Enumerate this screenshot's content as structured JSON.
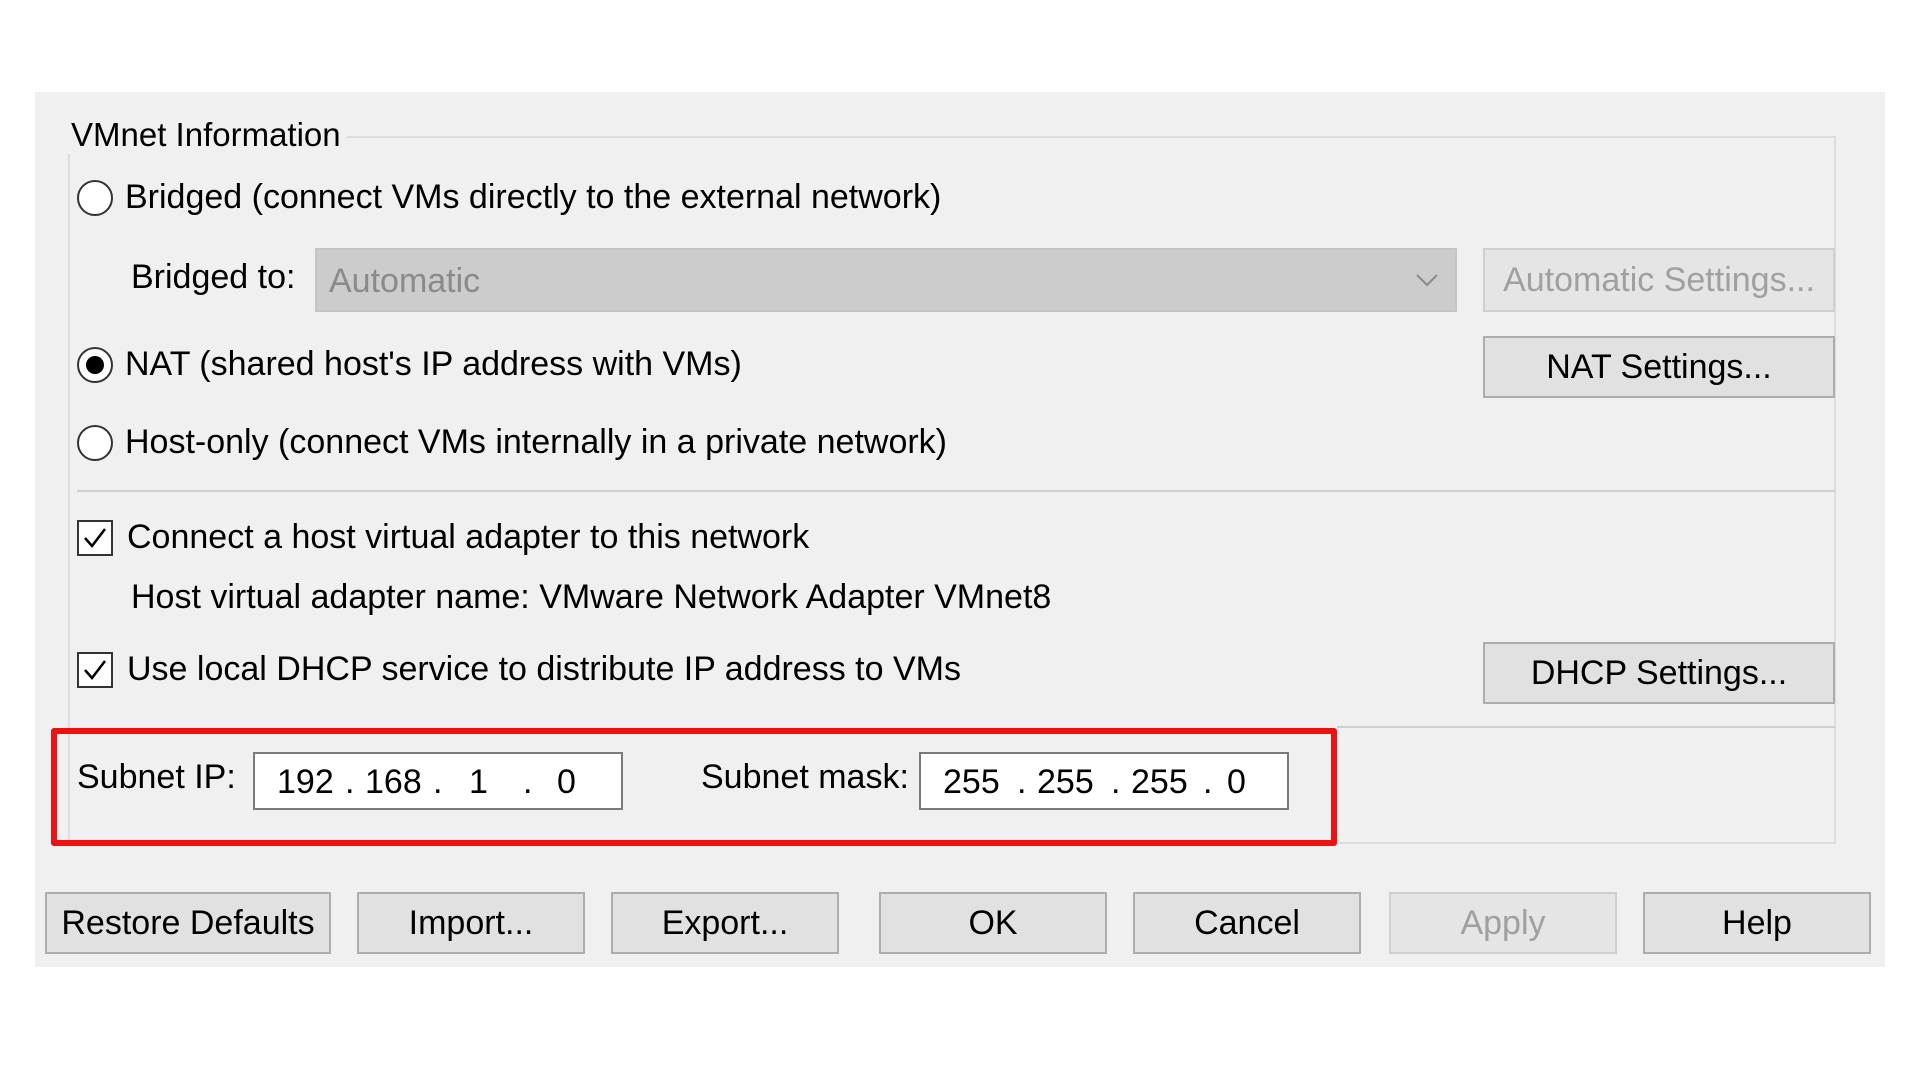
{
  "vmnet_info": {
    "legend": "VMnet Information",
    "bridged_label": "Bridged (connect VMs directly to the external network)",
    "bridged_to_label": "Bridged to:",
    "bridged_to_value": "Automatic",
    "automatic_settings_label": "Automatic Settings...",
    "nat_label": "NAT (shared host's IP address with VMs)",
    "nat_settings_label": "NAT Settings...",
    "hostonly_label": "Host-only (connect VMs internally in a private network)",
    "selected_mode": "NAT",
    "connect_adapter_label": "Connect a host virtual adapter to this network",
    "connect_adapter_checked": true,
    "adapter_name_text": "Host virtual adapter name: VMware Network Adapter VMnet8",
    "dhcp_label": "Use local DHCP service to distribute IP address to VMs",
    "dhcp_checked": true,
    "dhcp_settings_label": "DHCP Settings...",
    "subnet_ip_label": "Subnet IP:",
    "subnet_ip": [
      "192",
      "168",
      "1",
      "0"
    ],
    "subnet_mask_label": "Subnet mask:",
    "subnet_mask": [
      "255",
      "255",
      "255",
      "0"
    ]
  },
  "footer": {
    "restore_defaults": "Restore Defaults",
    "import": "Import...",
    "export": "Export...",
    "ok": "OK",
    "cancel": "Cancel",
    "apply": "Apply",
    "help": "Help"
  },
  "colors": {
    "highlight": "#ee1111",
    "dialog_bg": "#f0f0f0",
    "disabled_text": "#a0a0a0"
  }
}
